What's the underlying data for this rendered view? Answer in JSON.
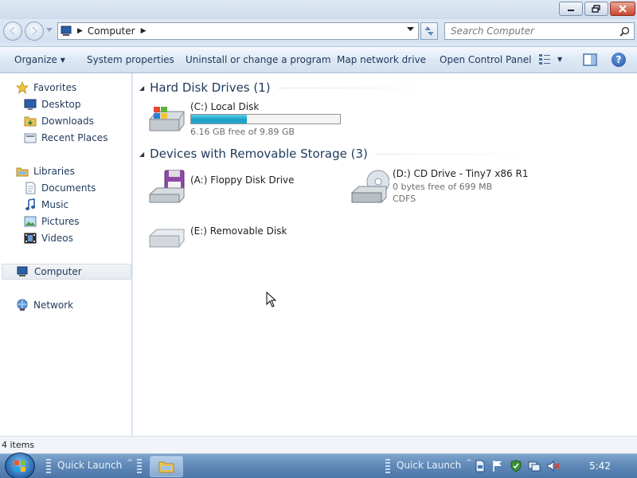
{
  "window": {
    "minimize_label": "minimize",
    "maximize_label": "restore",
    "close_label": "close"
  },
  "address": {
    "crumb": "Computer"
  },
  "search": {
    "placeholder": "Search Computer"
  },
  "toolbar": {
    "organize": "Organize",
    "system_properties": "System properties",
    "uninstall": "Uninstall or change a program",
    "map_drive": "Map network drive",
    "control_panel": "Open Control Panel",
    "help": "?"
  },
  "nav": {
    "favorites": "Favorites",
    "desktop": "Desktop",
    "downloads": "Downloads",
    "recent": "Recent Places",
    "libraries": "Libraries",
    "documents": "Documents",
    "music": "Music",
    "pictures": "Pictures",
    "videos": "Videos",
    "computer": "Computer",
    "network": "Network"
  },
  "groups": {
    "hdd": "Hard Disk Drives (1)",
    "removable": "Devices with Removable Storage (3)"
  },
  "drives": {
    "c": {
      "name": "(C:) Local Disk",
      "free": "6.16 GB free of 9.89 GB",
      "used_fraction": 0.377
    },
    "a": {
      "name": "(A:) Floppy Disk Drive"
    },
    "d": {
      "name": "(D:) CD Drive - Tiny7 x86 R1",
      "free": "0 bytes free of 699 MB",
      "fs": "CDFS"
    },
    "e": {
      "name": "(E:) Removable Disk"
    }
  },
  "status": {
    "items": "4 items"
  },
  "taskbar": {
    "quick_launch_1": "Quick Launch",
    "quick_launch_2": "Quick Launch",
    "clock": "5:42"
  },
  "icons": [
    "back-icon",
    "forward-icon",
    "computer-icon",
    "refresh-icon",
    "search-icon",
    "views-icon",
    "preview-pane-icon",
    "help-icon",
    "star-icon",
    "folder-icon",
    "drive-icon",
    "floppy-icon",
    "cd-icon",
    "network-icon",
    "start-icon"
  ]
}
